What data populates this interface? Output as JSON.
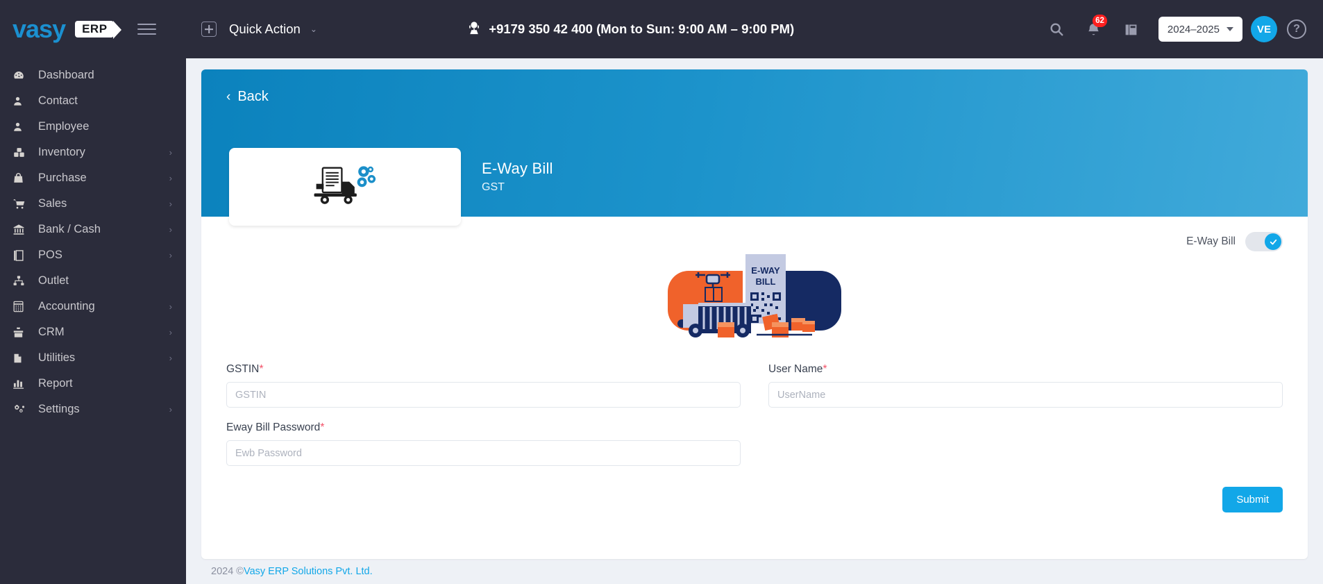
{
  "brand": {
    "name": "vasy",
    "suffix": "ERP"
  },
  "sidebar": {
    "items": [
      {
        "label": "Dashboard",
        "icon": "dashboard-icon",
        "has_caret": false
      },
      {
        "label": "Contact",
        "icon": "user-icon",
        "has_caret": false
      },
      {
        "label": "Employee",
        "icon": "user-icon",
        "has_caret": false
      },
      {
        "label": "Inventory",
        "icon": "boxes-icon",
        "has_caret": true
      },
      {
        "label": "Purchase",
        "icon": "bag-icon",
        "has_caret": true
      },
      {
        "label": "Sales",
        "icon": "cart-icon",
        "has_caret": true
      },
      {
        "label": "Bank / Cash",
        "icon": "bank-icon",
        "has_caret": true
      },
      {
        "label": "POS",
        "icon": "pos-icon",
        "has_caret": true
      },
      {
        "label": "Outlet",
        "icon": "sitemap-icon",
        "has_caret": false
      },
      {
        "label": "Accounting",
        "icon": "calculator-icon",
        "has_caret": true
      },
      {
        "label": "CRM",
        "icon": "gift-icon",
        "has_caret": true
      },
      {
        "label": "Utilities",
        "icon": "file-icon",
        "has_caret": true
      },
      {
        "label": "Report",
        "icon": "chart-bar-icon",
        "has_caret": false
      },
      {
        "label": "Settings",
        "icon": "gears-icon",
        "has_caret": true
      }
    ]
  },
  "topbar": {
    "quick_action": "Quick Action",
    "support_phone": "+9179 350 42 400 (Mon to Sun: 9:00 AM – 9:00 PM)",
    "notification_count": "62",
    "fiscal_year": "2024–2025",
    "avatar_initials": "VE",
    "help_label": "?"
  },
  "hero": {
    "back_label": "Back",
    "back_chevron": "‹",
    "title": "E-Way Bill",
    "subtitle": "GST",
    "card_icon": "truck-gear-icon"
  },
  "toggle": {
    "label": "E-Way Bill",
    "state": "on",
    "accent": "#12a7e8"
  },
  "illustration": {
    "name": "eway-bill-truck-illustration",
    "doc_line1": "E-WAY",
    "doc_line2": "BILL",
    "colors": {
      "orange": "#f0622b",
      "navy": "#152a63",
      "light": "#c3cae2"
    }
  },
  "form": {
    "fields": [
      {
        "name": "gstin",
        "label": "GSTIN",
        "required": true,
        "value": "",
        "placeholder": "GSTIN"
      },
      {
        "name": "username",
        "label": "User Name",
        "required": true,
        "value": "",
        "placeholder": "UserName"
      },
      {
        "name": "eway_password",
        "label": "Eway Bill Password",
        "required": true,
        "value": "",
        "placeholder": "Ewb Password"
      }
    ],
    "required_marker": "*",
    "submit_label": "Submit"
  },
  "footer": {
    "copyright": "2024 © ",
    "link": "Vasy ERP Solutions Pvt. Ltd."
  }
}
